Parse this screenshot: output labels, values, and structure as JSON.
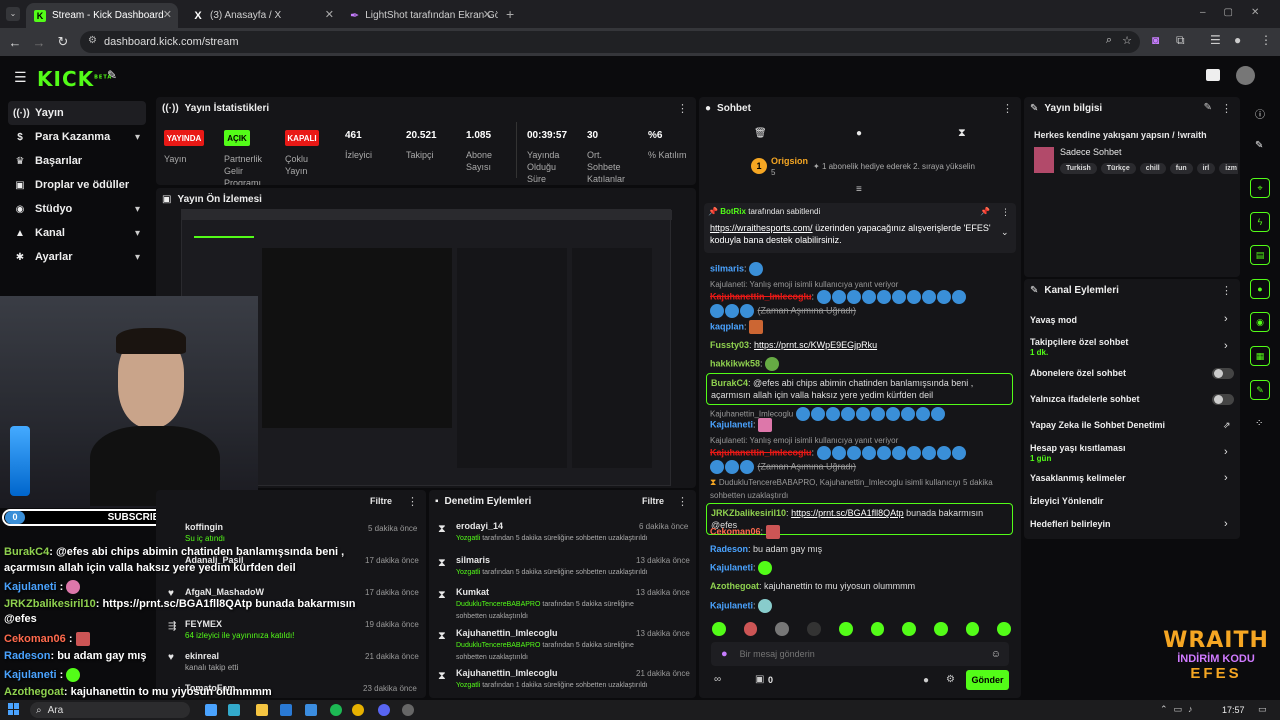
{
  "browser": {
    "tabs": [
      {
        "title": "Stream - Kick Dashboard"
      },
      {
        "title": "(3) Anasayfa / X"
      },
      {
        "title": "LightShot tarafından Ekran Gör"
      }
    ],
    "url": "dashboard.kick.com/stream"
  },
  "kick": {
    "logo": "KICK",
    "logo_sup": "BETA"
  },
  "sidebar": {
    "items": [
      {
        "label": "Yayın",
        "icon": "stream-icon"
      },
      {
        "label": "Para Kazanma",
        "icon": "money-icon"
      },
      {
        "label": "Başarılar",
        "icon": "trophy-icon"
      },
      {
        "label": "Droplar ve ödüller",
        "icon": "gift-icon"
      },
      {
        "label": "Stüdyo",
        "icon": "studio-icon"
      },
      {
        "label": "Kanal",
        "icon": "channel-icon"
      },
      {
        "label": "Ayarlar",
        "icon": "settings-icon"
      }
    ]
  },
  "stats": {
    "title": "Yayın İstatistikleri",
    "badges": [
      {
        "text": "YAYINDA",
        "label": "Yayın",
        "color": "#e91916"
      },
      {
        "text": "AÇIK",
        "label": "Partnerlik Gelir Programı",
        "color": "#53fc18"
      },
      {
        "text": "KAPALI",
        "label": "Çoklu Yayın",
        "color": "#e91916"
      }
    ],
    "metrics": [
      {
        "value": "461",
        "label": "İzleyici"
      },
      {
        "value": "20.521",
        "label": "Takipçi"
      },
      {
        "value": "1.085",
        "label": "Abone Sayısı"
      },
      {
        "value": "00:39:57",
        "label": "Yayında Olduğu Süre"
      },
      {
        "value": "30",
        "label": "Ort. Sohbete Katılanlar"
      },
      {
        "value": "%6",
        "label": "% Katılım"
      }
    ]
  },
  "preview": {
    "title": "Yayın Ön İzlemesi"
  },
  "overlay": {
    "subs_count_left": "0",
    "subs_title": "SUBSCRIBERS",
    "subs_count_right": "7",
    "chat": [
      {
        "user": "BurakC4",
        "text": ": @efes abi chips abimin chatinden banlamışsında beni ,",
        "color": "#8fd14f"
      },
      {
        "user": "",
        "text": "açarmısın allah için valla haksız yere yedim kürfden deil",
        "color": "#fff"
      },
      {
        "user": "Kajulaneti",
        "text": ":",
        "color": "#4aa3ff"
      },
      {
        "user": "JRKZbalikesiril10",
        "text": ": https://prnt.sc/BGA1fll8QAtp bunada bakarmısın",
        "color": "#8fd14f"
      },
      {
        "user": "",
        "text": "@efes",
        "color": "#fff"
      },
      {
        "user": "Cekoman06",
        "text": ":",
        "color": "#ff6a4d"
      },
      {
        "user": "Radeson",
        "text": ": bu adam gay mış",
        "color": "#4aa3ff"
      },
      {
        "user": "Kajulaneti",
        "text": ":",
        "color": "#4aa3ff"
      },
      {
        "user": "Azothegoat",
        "text": ": kajuhanettin to mu yiyosun olummmm",
        "color": "#8fd14f"
      }
    ],
    "wraith_line1": "WRAITH",
    "wraith_line2": "İNDİRİM KODU",
    "wraith_line3": "EFES"
  },
  "activity": {
    "filter": "Filtre",
    "rows": [
      {
        "name": "koffingin",
        "sub": "Su iç atındı",
        "time": "5 dakika önce"
      },
      {
        "name": "Adanali_Pasil",
        "sub": "",
        "time": "17 dakika önce"
      },
      {
        "name": "AfgaN_MashadoW",
        "sub": "",
        "time": "17 dakika önce"
      },
      {
        "name": "FEYMEX",
        "sub": "64 izleyici ile yayınınıza katıldı!",
        "time": "19 dakika önce"
      },
      {
        "name": "ekinreal",
        "sub": "kanalı takip etti",
        "time": "21 dakika önce"
      },
      {
        "name": "TomatoFam",
        "sub": "",
        "time": "23 dakika önce"
      }
    ]
  },
  "modlog": {
    "title": "Denetim Eylemleri",
    "filter": "Filtre",
    "rows": [
      {
        "name": "erodayi_14",
        "actor": "Yozgatli",
        "text": "tarafından 5 dakika süreliğine sohbetten uzaklaştırıldı",
        "time": "6 dakika önce"
      },
      {
        "name": "silmaris",
        "actor": "Yozgatli",
        "text": "tarafından 5 dakika süreliğine sohbetten uzaklaştırıldı",
        "time": "13 dakika önce"
      },
      {
        "name": "Kumkat",
        "actor": "DudukluTencereBABAPRO",
        "text": "tarafından 5 dakika süreliğine sohbetten uzaklaştırıldı",
        "time": "13 dakika önce"
      },
      {
        "name": "Kajuhanettin_Imlecoglu",
        "actor": "DudukluTencereBABAPRO",
        "text": "tarafından 5 dakika süreliğine sohbetten uzaklaştırıldı",
        "time": "13 dakika önce"
      },
      {
        "name": "Kajuhanettin_Imlecoglu",
        "actor": "Yozgatli",
        "text": "tarafından 1 dakika süreliğine sohbetten uzaklaştırıldı",
        "time": "21 dakika önce"
      }
    ]
  },
  "chat": {
    "title": "Sohbet",
    "top_user": "Origsion",
    "top_count": "5",
    "top_note": "1 abonelik hediye ederek 2. sıraya yükselin",
    "pinned_user": "BotRix",
    "pinned_by": "tarafından sabitlendi",
    "pinned_link": "https://wraithesports.com/",
    "pinned_text": "üzerinden yapacağınız alışverişlerde 'EFES' koduyla bana destek olabilirsiniz.",
    "messages": [
      {
        "user": "silmaris",
        "color": "#4aa3ff",
        "text": "",
        "system": ""
      },
      {
        "user": "",
        "color": "",
        "text": "",
        "system": "Kajulaneti: Yanlış emoji isimli kullanıcıya yanıt veriyor"
      },
      {
        "user": "Kajuhanettin_Imlecoglu",
        "color": "#e91916",
        "text": "(Zaman Aşımına Uğradı)",
        "system": ""
      },
      {
        "user": "kaqplan",
        "color": "#4aa3ff",
        "text": "",
        "system": ""
      },
      {
        "user": "Fussty03",
        "color": "#8fd14f",
        "text": "https://prnt.sc/KWpE9EGjpRku",
        "system": ""
      },
      {
        "user": "hakkikwk58",
        "color": "#8fd14f",
        "text": "",
        "system": ""
      }
    ],
    "highlight1_user": "BurakC4",
    "highlight1_text": "@efes abi chips abimin chatinden banlamışsında beni , açarmısın allah için valla haksız yere yedim kürfden deil",
    "messages2": [
      {
        "user": "Kajuhanettin_Imlecoglu",
        "color": "#999",
        "text": "",
        "system": ""
      },
      {
        "user": "Kajulaneti",
        "color": "#4aa3ff",
        "text": "",
        "system": ""
      },
      {
        "user": "",
        "color": "",
        "text": "",
        "system": "Kajulaneti: Yanlış emoji isimli kullanıcıya yanıt veriyor"
      },
      {
        "user": "Kajuhanettin_Imlecoglu",
        "color": "#e91916",
        "text": "(Zaman Aşımına Uğradı)",
        "system": ""
      }
    ],
    "ban_note": "DudukluTencereBABAPRO, Kajuhanettin_Imlecoglu isimli kullanıcıyı 5 dakika sohbetten uzaklaştırdı",
    "highlight2_user": "JRKZbalikesiril10",
    "highlight2_link": "https://prnt.sc/BGA1fll8QAtp",
    "highlight2_text": "bunada bakarmısın @efes",
    "messages3": [
      {
        "user": "Cekoman06",
        "color": "#ff6a4d",
        "text": ""
      },
      {
        "user": "Radeson",
        "color": "#4aa3ff",
        "text": "bu adam gay mış"
      },
      {
        "user": "Kajulaneti",
        "color": "#4aa3ff",
        "text": ""
      },
      {
        "user": "Azothegoat",
        "color": "#8fd14f",
        "text": "kajuhanettin to mu yiyosun olummmm"
      },
      {
        "user": "Kajulaneti",
        "color": "#4aa3ff",
        "text": ""
      }
    ],
    "input_placeholder": "Bir mesaj gönderin",
    "points": "0",
    "send": "Gönder"
  },
  "info": {
    "title": "Yayın bilgisi",
    "stream_title": "Herkes kendine yakışanı yapsın / !wraith",
    "category": "Sadece Sohbet",
    "tags": [
      "Turkish",
      "Türkçe",
      "chill",
      "fun",
      "irl",
      "izm"
    ]
  },
  "actions": {
    "title": "Kanal Eylemleri",
    "items": [
      {
        "label": "Yavaş mod",
        "sub": "",
        "type": "chevron"
      },
      {
        "label": "Takipçilere özel sohbet",
        "sub": "1 dk.",
        "type": "chevron"
      },
      {
        "label": "Abonelere özel sohbet",
        "sub": "",
        "type": "toggle"
      },
      {
        "label": "Yalnızca ifadelerle sohbet",
        "sub": "",
        "type": "toggle"
      },
      {
        "label": "Yapay Zeka ile Sohbet Denetimi",
        "sub": "",
        "type": "external"
      },
      {
        "label": "Hesap yaşı kısıtlaması",
        "sub": "1 gün",
        "type": "chevron"
      },
      {
        "label": "Yasaklanmış kelimeler",
        "sub": "",
        "type": "chevron"
      },
      {
        "label": "İzleyici Yönlendir",
        "sub": "",
        "type": "none"
      },
      {
        "label": "Hedefleri belirleyin",
        "sub": "",
        "type": "chevron"
      }
    ]
  },
  "promo": {
    "line1": "WRAITH",
    "line2": "İNDİRİM KODU",
    "line3": "EFES"
  },
  "taskbar": {
    "search": "Ara",
    "time": "17:57"
  },
  "colors": {
    "kick_green": "#53fc18",
    "live_red": "#e91916",
    "panel_bg": "#151518"
  }
}
